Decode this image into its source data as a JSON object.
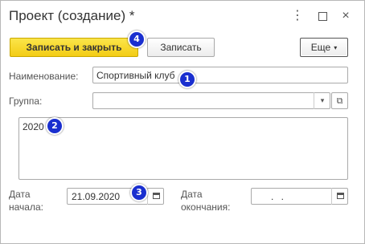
{
  "window": {
    "title": "Проект (создание) *",
    "menu_icon": "⋮",
    "close_icon": "×"
  },
  "toolbar": {
    "save_close_label": "Записать и закрыть",
    "save_label": "Записать",
    "more_label": "Еще",
    "more_arrow": "▾"
  },
  "form": {
    "name_label": "Наименование:",
    "name_value": "Спортивный клуб",
    "group_label": "Группа:",
    "group_value": "",
    "group_drop": "▾",
    "group_open": "⧉",
    "comment_value": "2020",
    "start_label": "Дата начала:",
    "start_value": "21.09.2020",
    "end_label": "Дата окончания:",
    "end_value": ". ."
  },
  "badges": [
    "1",
    "2",
    "3",
    "4"
  ]
}
